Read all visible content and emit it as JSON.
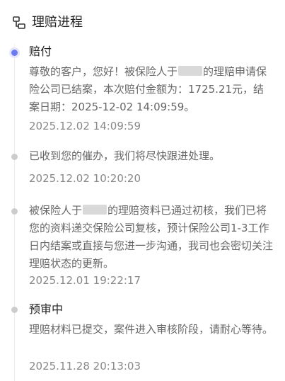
{
  "header": {
    "title": "理赔进程",
    "icon": "claim-progress-icon"
  },
  "timeline": {
    "items": [
      {
        "status": "active",
        "title": "赔付",
        "text_before": "尊敬的客户，您好！被保险人于",
        "text_after": "的理赔申请保险公司已结案，本次赔付金额为：1725.21元，结案日期：2025-12-02 14:09:59。",
        "time": "2025.12.02 14:09:59"
      },
      {
        "status": "normal",
        "title": "",
        "text": "已收到您的催办，我们将尽快跟进处理。",
        "time": "2025.12.02 10:20:20"
      },
      {
        "status": "normal",
        "title": "",
        "text_before": "被保险人于",
        "text_after": "的理赔资料已通过初核，我们已将您的资料递交保险公司复核，预计保险公司1-3工作日内结案或直接与您进一步沟通，我司也会密切关注理赔状态的更新。",
        "time": "2025.12.01 19:22:17"
      },
      {
        "status": "normal",
        "title": "预审中",
        "text": "理赔材料已提交，案件进入审核阶段，请耐心等待。",
        "time": "2025.11.28 20:13:03"
      }
    ]
  },
  "colors": {
    "active_dot": "#6c7cf0",
    "normal_dot": "#cccccc",
    "rail": "#ececec",
    "title": "#222222",
    "body_text": "#666666",
    "time_text": "#888888"
  }
}
